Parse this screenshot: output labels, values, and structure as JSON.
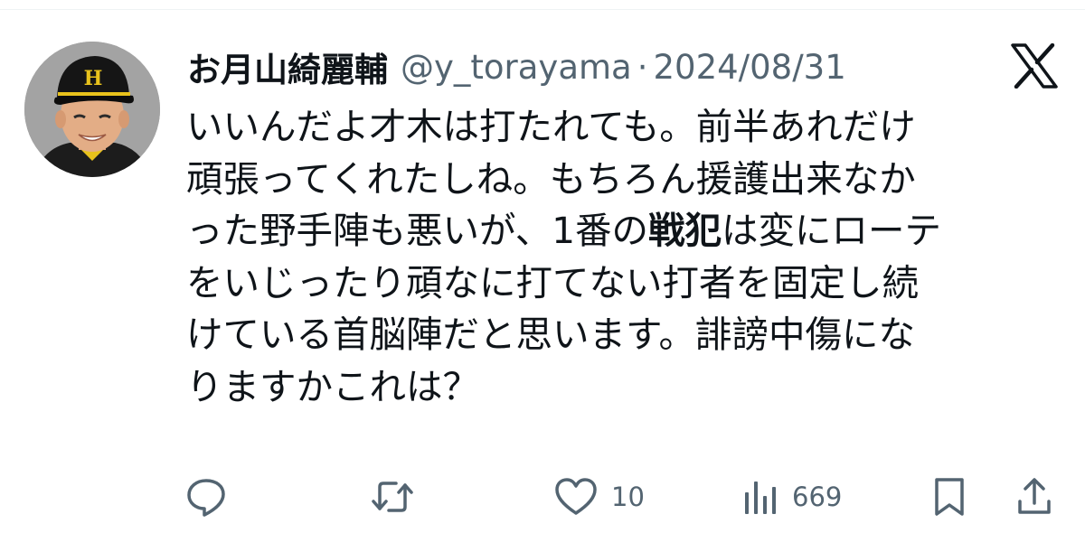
{
  "tweet": {
    "author": {
      "display_name": "お月山綺麗輔",
      "handle": "@y_torayama",
      "separator": "·",
      "date": "2024/08/31",
      "avatar": "avatar-baseball-player-icon"
    },
    "platform_icon": "x-logo-icon",
    "body": {
      "line1": "いいんだよ才木は打たれても。前半あれだけ",
      "line2": "頑張ってくれたしね。もちろん援護出来なか",
      "line3_before": "った野手陣も悪いが、1番の",
      "line3_bold": "戦犯",
      "line3_after": "は変にローテ",
      "line4": "をいじったり頑なに打てない打者を固定し続",
      "line5": "けている首脳陣だと思います。誹謗中傷にな",
      "line6": "りますかこれは？"
    },
    "actions": {
      "reply": {
        "icon": "reply-icon",
        "count": ""
      },
      "retweet": {
        "icon": "retweet-icon",
        "count": ""
      },
      "like": {
        "icon": "heart-icon",
        "count": "10"
      },
      "views": {
        "icon": "views-chart-icon",
        "count": "669"
      },
      "bookmark": {
        "icon": "bookmark-icon"
      },
      "share": {
        "icon": "share-icon"
      }
    },
    "colors": {
      "text": "#0f1419",
      "secondary": "#536471"
    }
  }
}
